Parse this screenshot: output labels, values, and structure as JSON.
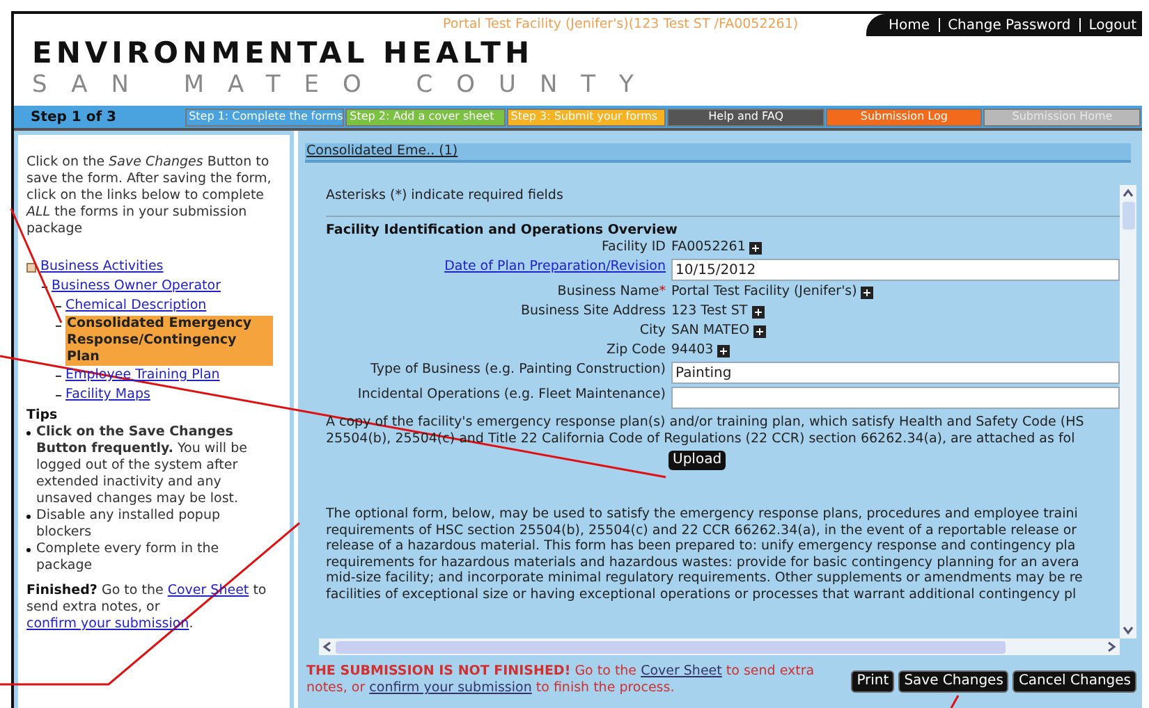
{
  "header": {
    "facility": "Portal Test Facility (Jenifer's)(123 Test ST /FA0052261)",
    "links": [
      "Home",
      "Change Password",
      "Logout"
    ],
    "title": "ENVIRONMENTAL HEALTH",
    "subtitle": "SAN MATEO COUNTY"
  },
  "step_bar": {
    "label": "Step 1 of 3",
    "items": [
      {
        "label": "Step 1: Complete the forms",
        "color": "#4aa3df",
        "disabled": false
      },
      {
        "label": "Step 2: Add a cover sheet",
        "color": "#7cc242",
        "disabled": false
      },
      {
        "label": "Step 3: Submit your forms",
        "color": "#f5b323",
        "disabled": false
      },
      {
        "label": "Help and FAQ",
        "color": "#555555",
        "disabled": false
      },
      {
        "label": "Submission Log",
        "color": "#f26a1b",
        "disabled": false
      },
      {
        "label": "Submission Home",
        "color": "#b8b8b8",
        "disabled": true
      }
    ]
  },
  "sidebar": {
    "intro": "Click on the *Save Changes* Button to save the form. After saving the form, click on the links below to complete *ALL* the forms in your submission package",
    "tree": [
      {
        "label": "Business Activities",
        "selected": false,
        "children": [
          {
            "label": "Business Owner Operator",
            "selected": false,
            "children": [
              {
                "label": "Chemical Description",
                "selected": false
              },
              {
                "label": "Consolidated Emergency Response/Contingency Plan",
                "selected": true
              },
              {
                "label": "Employee Training Plan",
                "selected": false
              },
              {
                "label": "Facility Maps",
                "selected": false
              }
            ]
          }
        ]
      }
    ],
    "tips_title": "Tips",
    "tips": [
      "**Click on the Save Changes Button frequently.** You will be logged out of the system after extended inactivity and any unsaved changes may be lost.",
      "Disable any installed popup blockers",
      "Complete every form in the package"
    ],
    "finished": {
      "lead": "Finished?",
      "text1": "Go to the",
      "link1": "Cover Sheet",
      "text2": "to send extra notes, or",
      "link2": "confirm your submission",
      "text3": "."
    }
  },
  "form": {
    "heading": "Consolidated Eme.. (1)",
    "required_note": "Asterisks (*) indicate required fields",
    "section": "Facility Identification and Operations Overview",
    "fields": [
      {
        "kind": "display",
        "label": "Facility ID",
        "value": "FA0052261",
        "link": false,
        "required": false
      },
      {
        "kind": "input",
        "label": "Date of Plan Preparation/Revision",
        "value": "10/15/2012",
        "link": true,
        "required": false
      },
      {
        "kind": "display",
        "label": "Business Name",
        "value": "Portal Test Facility (Jenifer's)",
        "link": false,
        "required": true
      },
      {
        "kind": "display",
        "label": "Business Site Address",
        "value": "123 Test ST",
        "link": false,
        "required": false
      },
      {
        "kind": "display",
        "label": "City",
        "value": "SAN MATEO",
        "link": false,
        "required": false
      },
      {
        "kind": "display",
        "label": "Zip Code",
        "value": "94403",
        "link": false,
        "required": false
      },
      {
        "kind": "input",
        "label": "Type of Business (e.g. Painting Construction)",
        "value": "Painting",
        "link": false,
        "required": false
      },
      {
        "kind": "input",
        "label": "Incidental Operations (e.g. Fleet Maintenance)",
        "link": false,
        "required": false
      }
    ],
    "required_mark": "*",
    "copy_lines": [
      "A copy of the facility's emergency response plan(s) and/or training plan, which satisfy Health and Safety Code (HS",
      "25504(b), 25504(c) and Title 22 California Code of Regulations (22 CCR) section 66262.34(a), are attached as fol"
    ],
    "upload": "Upload",
    "optional_lines": [
      "The optional form, below, may be used to satisfy the emergency response plans, procedures and employee traini",
      "requirements of HSC section 25504(b), 25504(c) and 22 CCR 66262.34(a), in the event of a reportable release or",
      "release of a hazardous material. This form has been prepared to: unify emergency response and contingency pla",
      "requirements for hazardous materials and hazardous wastes: provide for basic contingency planning for an avera",
      "mid-size facility; and incorporate minimal regulatory requirements. Other supplements or amendments may be re",
      "facilities of exceptional size or having exceptional operations or processes that warrant additional contingency pl"
    ]
  },
  "footer": {
    "warning": "THE SUBMISSION IS NOT FINISHED!",
    "text1": "Go to the",
    "link1": "Cover Sheet",
    "text2": "to send extra notes, or",
    "link2": "confirm your submission",
    "text3": "to finish the process.",
    "buttons": [
      "Print",
      "Save Changes",
      "Cancel Changes"
    ]
  }
}
